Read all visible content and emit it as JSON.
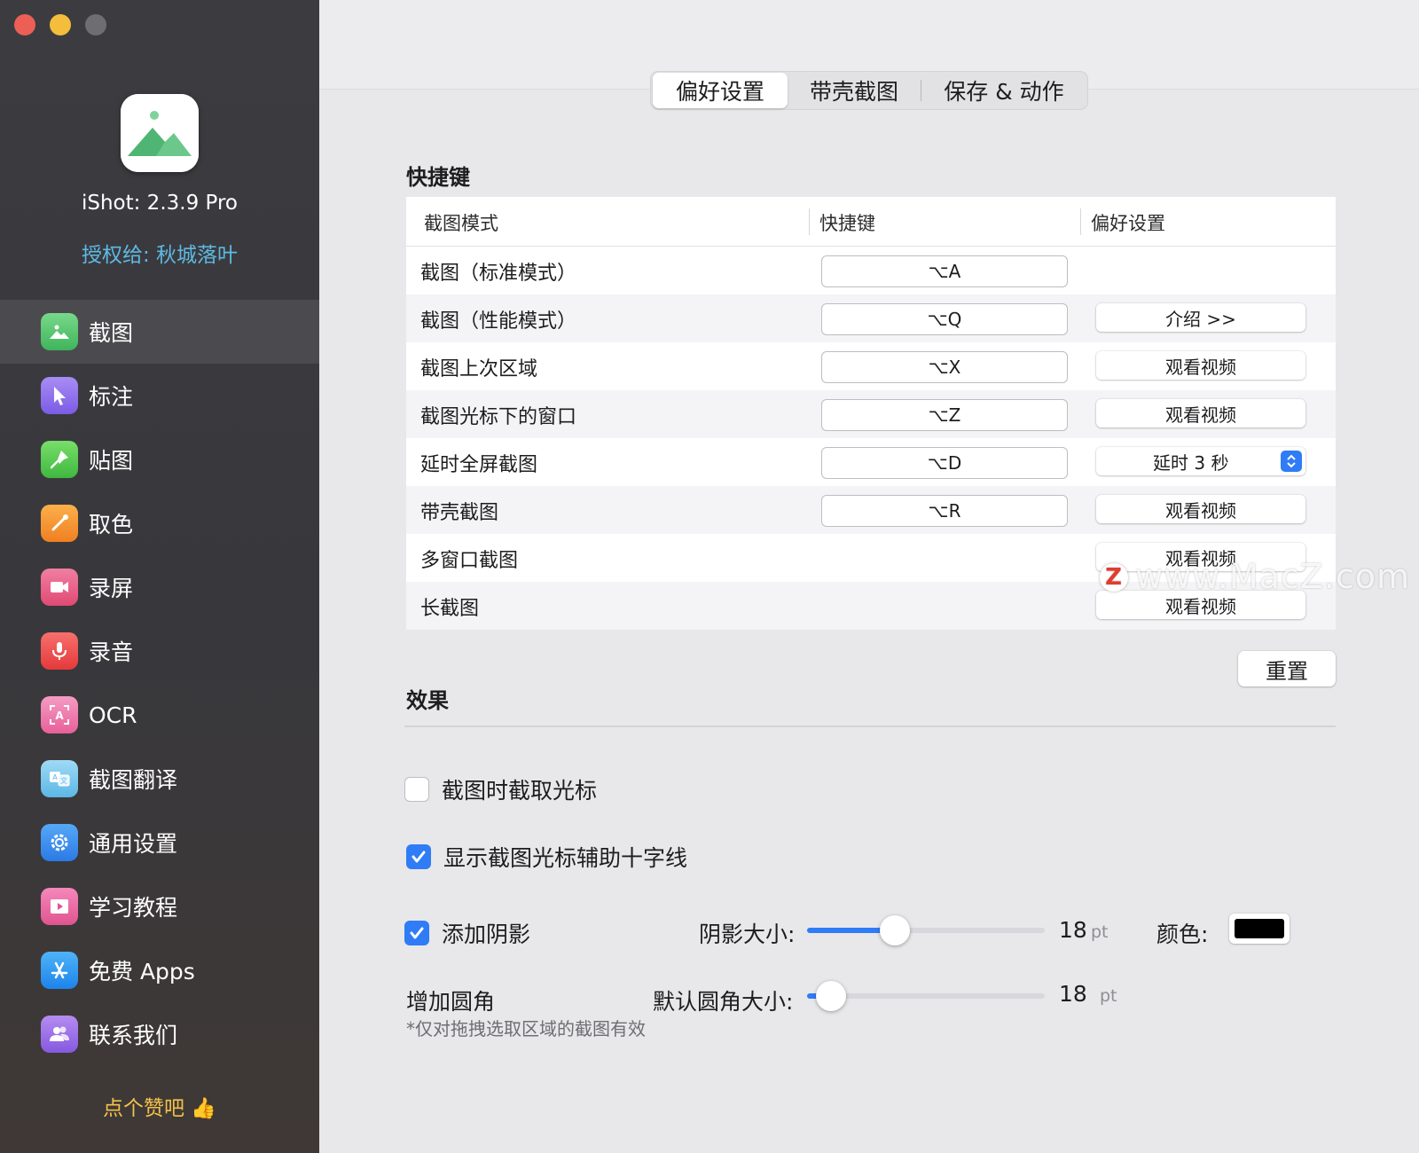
{
  "sidebar": {
    "app_version": "iShot: 2.3.9 Pro",
    "license": "授权给: 秋城落叶",
    "items": [
      {
        "label": "截图",
        "icon": "screenshot-icon",
        "active": true
      },
      {
        "label": "标注",
        "icon": "cursor-icon"
      },
      {
        "label": "贴图",
        "icon": "pin-icon"
      },
      {
        "label": "取色",
        "icon": "eyedropper-icon"
      },
      {
        "label": "录屏",
        "icon": "video-camera-icon"
      },
      {
        "label": "录音",
        "icon": "microphone-icon"
      },
      {
        "label": "OCR",
        "icon": "ocr-icon"
      },
      {
        "label": "截图翻译",
        "icon": "translate-icon"
      },
      {
        "label": "通用设置",
        "icon": "gear-icon"
      },
      {
        "label": "学习教程",
        "icon": "tutorial-icon"
      },
      {
        "label": "免费 Apps",
        "icon": "app-store-icon"
      },
      {
        "label": "联系我们",
        "icon": "contacts-icon"
      }
    ],
    "like_text": "点个赞吧 👍"
  },
  "tabs": [
    {
      "label": "偏好设置",
      "active": true
    },
    {
      "label": "带壳截图"
    },
    {
      "label": "保存 & 动作"
    }
  ],
  "shortcuts": {
    "title": "快捷键",
    "headers": [
      "截图模式",
      "快捷键",
      "偏好设置"
    ],
    "rows": [
      {
        "mode": "截图（标准模式）",
        "key": "⌥A",
        "pref": ""
      },
      {
        "mode": "截图（性能模式）",
        "key": "⌥Q",
        "pref": "介绍 >>"
      },
      {
        "mode": "截图上次区域",
        "key": "⌥X",
        "pref": "观看视频"
      },
      {
        "mode": "截图光标下的窗口",
        "key": "⌥Z",
        "pref": "观看视频"
      },
      {
        "mode": "延时全屏截图",
        "key": "⌥D",
        "pref": "延时 3 秒"
      },
      {
        "mode": "带壳截图",
        "key": "⌥R",
        "pref": "观看视频"
      },
      {
        "mode": "多窗口截图",
        "key": "",
        "pref": "观看视频"
      },
      {
        "mode": "长截图",
        "key": "",
        "pref": "观看视频"
      }
    ],
    "reset_label": "重置"
  },
  "watermark": {
    "badge": "Z",
    "text": "www.MacZ.com"
  },
  "effects": {
    "title": "效果",
    "capture_cursor": {
      "label": "截图时截取光标",
      "checked": false
    },
    "crosshair": {
      "label": "显示截图光标辅助十字线",
      "checked": true
    },
    "shadow": {
      "label": "添加阴影",
      "checked": true,
      "size_label": "阴影大小:",
      "size_value": "18",
      "size_unit": "pt",
      "size_fraction": 0.37,
      "color_label": "颜色:",
      "color": "#000000"
    },
    "corner": {
      "label": "增加圆角",
      "note": "*仅对拖拽选取区域的截图有效",
      "size_label": "默认圆角大小:",
      "size_value": "18",
      "size_unit": "pt",
      "size_fraction": 0.1
    }
  },
  "colors": {
    "accent": "#2f7cf6",
    "license_text": "#5db9e3",
    "like_text": "#f3c14a"
  }
}
